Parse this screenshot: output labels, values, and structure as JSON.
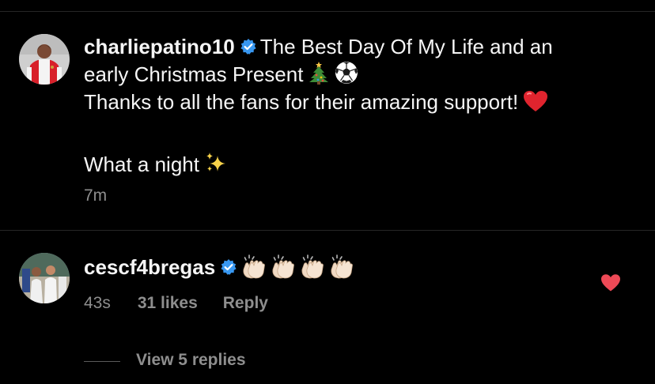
{
  "post": {
    "username": "charliepatino10",
    "caption_line1": "The Best Day Of My Life and an",
    "caption_line2": "early Christmas Present",
    "caption_line3": "Thanks to all the fans for their amazing support!",
    "caption_line4": "What a night",
    "timestamp": "7m",
    "icons": [
      "verified-badge-icon",
      "christmas-tree-icon",
      "soccer-ball-icon",
      "red-heart-icon",
      "sparkles-icon"
    ]
  },
  "comment": {
    "username": "cescf4bregas",
    "emoji_count": 4,
    "emoji_name": "clapping-hands-icon",
    "timestamp": "43s",
    "likes": "31 likes",
    "reply_label": "Reply",
    "liked": true,
    "view_replies": "View 5 replies"
  },
  "colors": {
    "background": "#000000",
    "primary_text": "#f5f5f5",
    "secondary_text": "#8e8e8e",
    "verified_blue": "#3897f0",
    "like_red": "#ed4956"
  }
}
